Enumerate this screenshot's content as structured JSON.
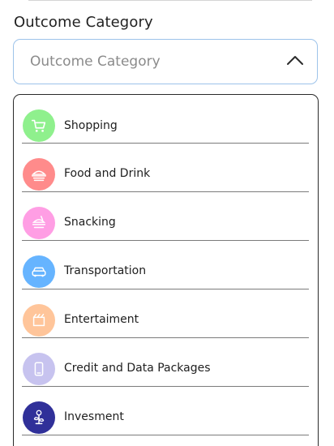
{
  "form": {
    "label": "Outcome Category",
    "select": {
      "placeholder": "Outcome Category"
    }
  },
  "options": [
    {
      "label": "Shopping",
      "icon": "cart-icon",
      "color": "#8ff08d"
    },
    {
      "label": "Food and Drink",
      "icon": "food-drink-icon",
      "color": "#ff8b8b"
    },
    {
      "label": "Snacking",
      "icon": "snack-icon",
      "color": "#ff9ee4"
    },
    {
      "label": "Transportation",
      "icon": "car-icon",
      "color": "#66b4ff"
    },
    {
      "label": "Entertaiment",
      "icon": "clapperboard-icon",
      "color": "#ffc59a"
    },
    {
      "label": "Credit and Data Packages",
      "icon": "phone-icon",
      "color": "#c7c3ef"
    },
    {
      "label": "Invesment",
      "icon": "money-plant-icon",
      "color": "#303099"
    }
  ]
}
